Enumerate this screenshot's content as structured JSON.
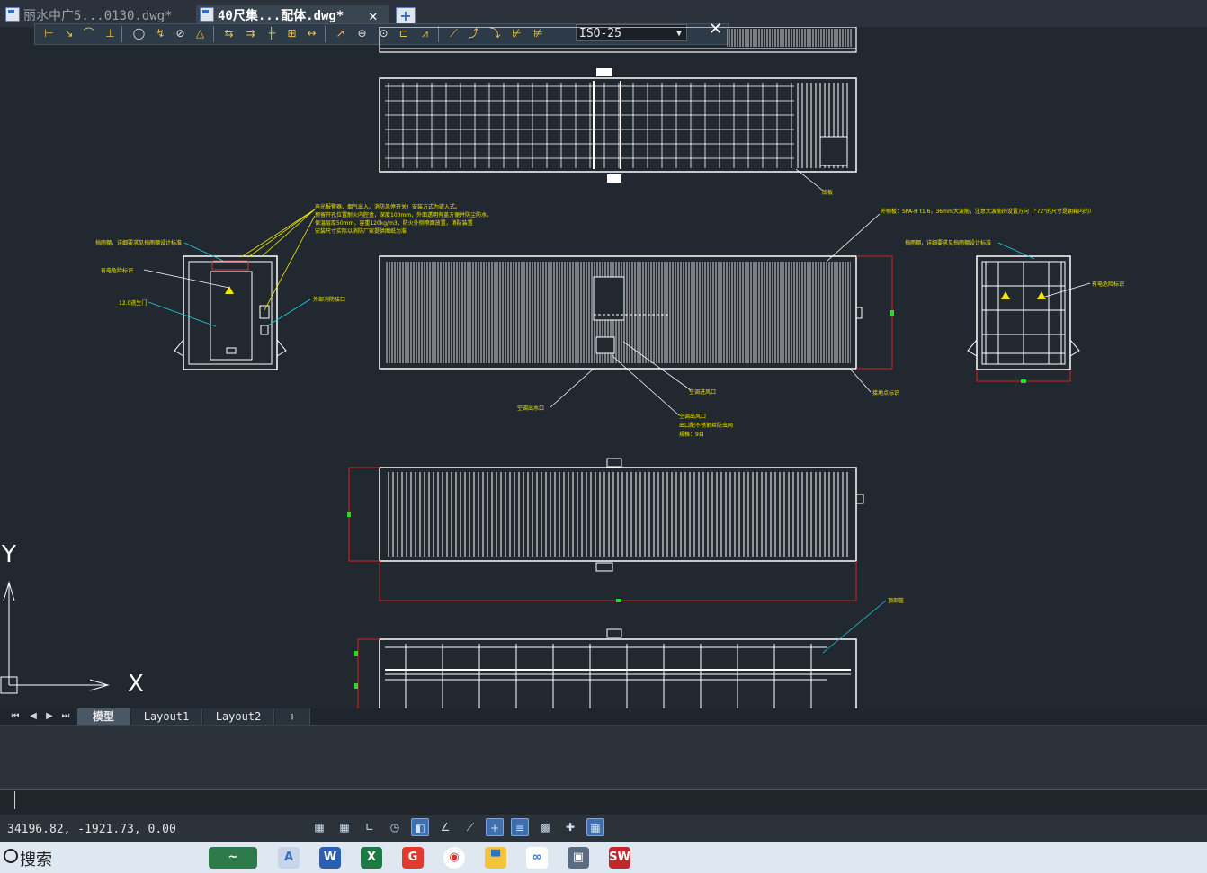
{
  "tabs": [
    {
      "label": "丽水中广5...0130.dwg*",
      "active": false
    },
    {
      "label": "40尺集...配体.dwg*",
      "active": true
    }
  ],
  "toolbar": {
    "dimstyle_value": "ISO-25",
    "icons": [
      "linear-dim-icon",
      "aligned-dim-icon",
      "arc-length-icon",
      "ordinate-icon",
      "radius-icon",
      "jogged-icon",
      "diameter-icon",
      "angular-icon",
      "quick-dim-icon",
      "baseline-icon",
      "continue-icon",
      "space-icon",
      "break-icon",
      "tolerance-icon",
      "center-mark-icon",
      "inspect-icon",
      "jogged-linear-icon",
      "dim-edit-icon",
      "dim-text-edit-icon",
      "update-icon",
      "dim-style-icon"
    ]
  },
  "drawing": {
    "note_top": [
      "声光报警器、烟气出入、消防急停开关）安装方式为嵌入式。",
      "预留开孔位置耐火内腔盒，深度100mm，外面透明有盖方便并防尘防水。",
      "保温层厚50mm，容重120kg/m3，防火外侧喷面放置，消防装置",
      "安装尺寸实际以消防厂家提供图纸为准"
    ],
    "label_left_1": "挡雨棚，详细要求见挡雨棚设计标准",
    "label_left_2": "有电危险标识",
    "label_left_3": "12.0逃生门",
    "label_left_4": "外部消防接口",
    "label_top_right": "外侧板：SPA-H t1.6，36mm大波筋，注意大波筋的设置方向（\"72\"的尺寸是朝箱内的）",
    "label_right_1": "挡雨棚，详细要求见挡雨棚设计标准",
    "label_right_2": "有电危险标识",
    "label_grounding": "接地点标识",
    "label_floor": "底板",
    "label_ac_drain": "空调出水口",
    "label_ac_in": "空调进风口",
    "label_ac_out_1": "空调出风口",
    "label_ac_out_2": "出口配不锈钢丝防虫网",
    "label_ac_out_3": "规格：9目",
    "label_roof": "顶部盖",
    "ucs_x": "X",
    "ucs_y": "Y"
  },
  "layout_tabs": [
    "模型",
    "Layout1",
    "Layout2",
    "+"
  ],
  "status": {
    "coords": "34196.82, -1921.73, 0.00"
  },
  "taskbar": {
    "search_label": "搜索",
    "apps": [
      "widgets-icon",
      "cad-app-icon",
      "word-icon",
      "excel-icon",
      "wps-icon",
      "chrome-icon",
      "explorer-icon",
      "baidu-netdisk-icon",
      "remote-desktop-icon",
      "solidworks-icon"
    ]
  }
}
